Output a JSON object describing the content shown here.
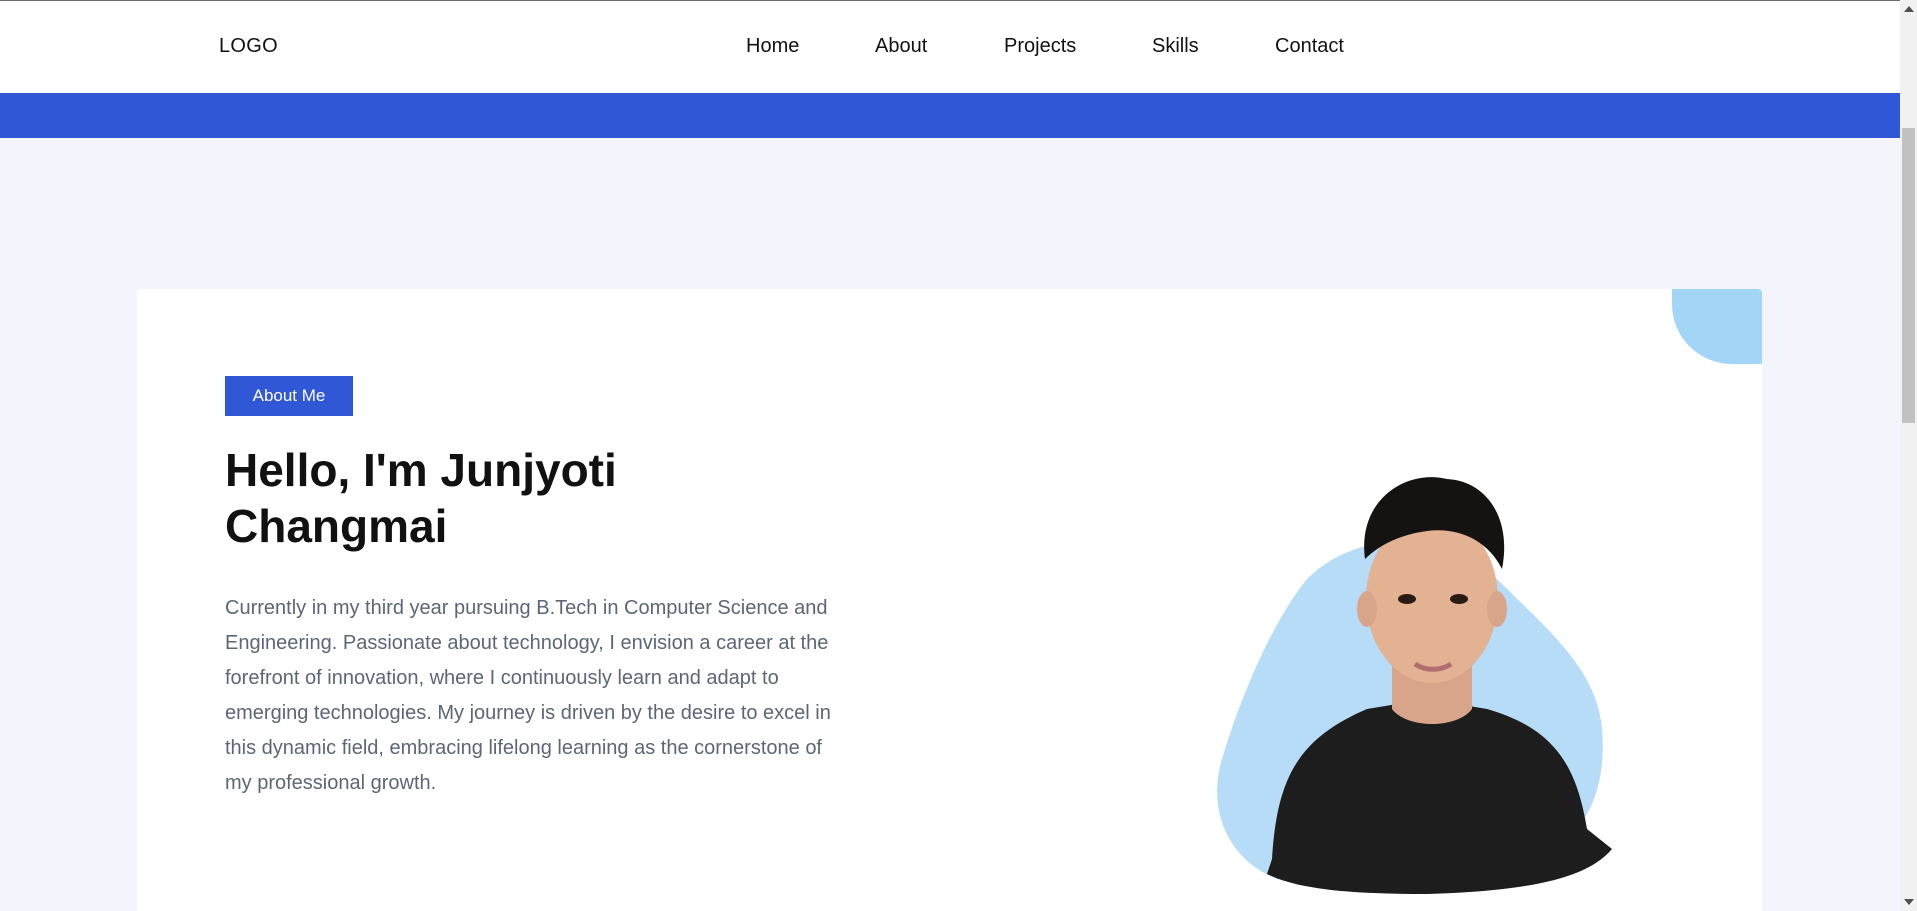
{
  "nav": {
    "logo": "LOGO",
    "links": [
      {
        "label": "Home"
      },
      {
        "label": "About"
      },
      {
        "label": "Projects"
      },
      {
        "label": "Skills"
      },
      {
        "label": "Contact"
      }
    ]
  },
  "about": {
    "badge": "About Me",
    "headline": "Hello, I'm Junjyoti Changmai",
    "bio": "Currently in my third year pursuing B.Tech in Computer Science and Engineering. Passionate about technology, I envision a career at the forefront of innovation, where I continuously learn and adapt to emerging technologies. My journey is driven by the desire to excel in this dynamic field, embracing lifelong learning as the cornerstone of my professional growth."
  },
  "colors": {
    "accent": "#3057d5",
    "blob": "#a3d6f6",
    "page_background": "#f3f4fc"
  },
  "icons": {
    "photo": "profile-photo",
    "scroll_up": "triangle-up",
    "scroll_down": "triangle-down"
  }
}
